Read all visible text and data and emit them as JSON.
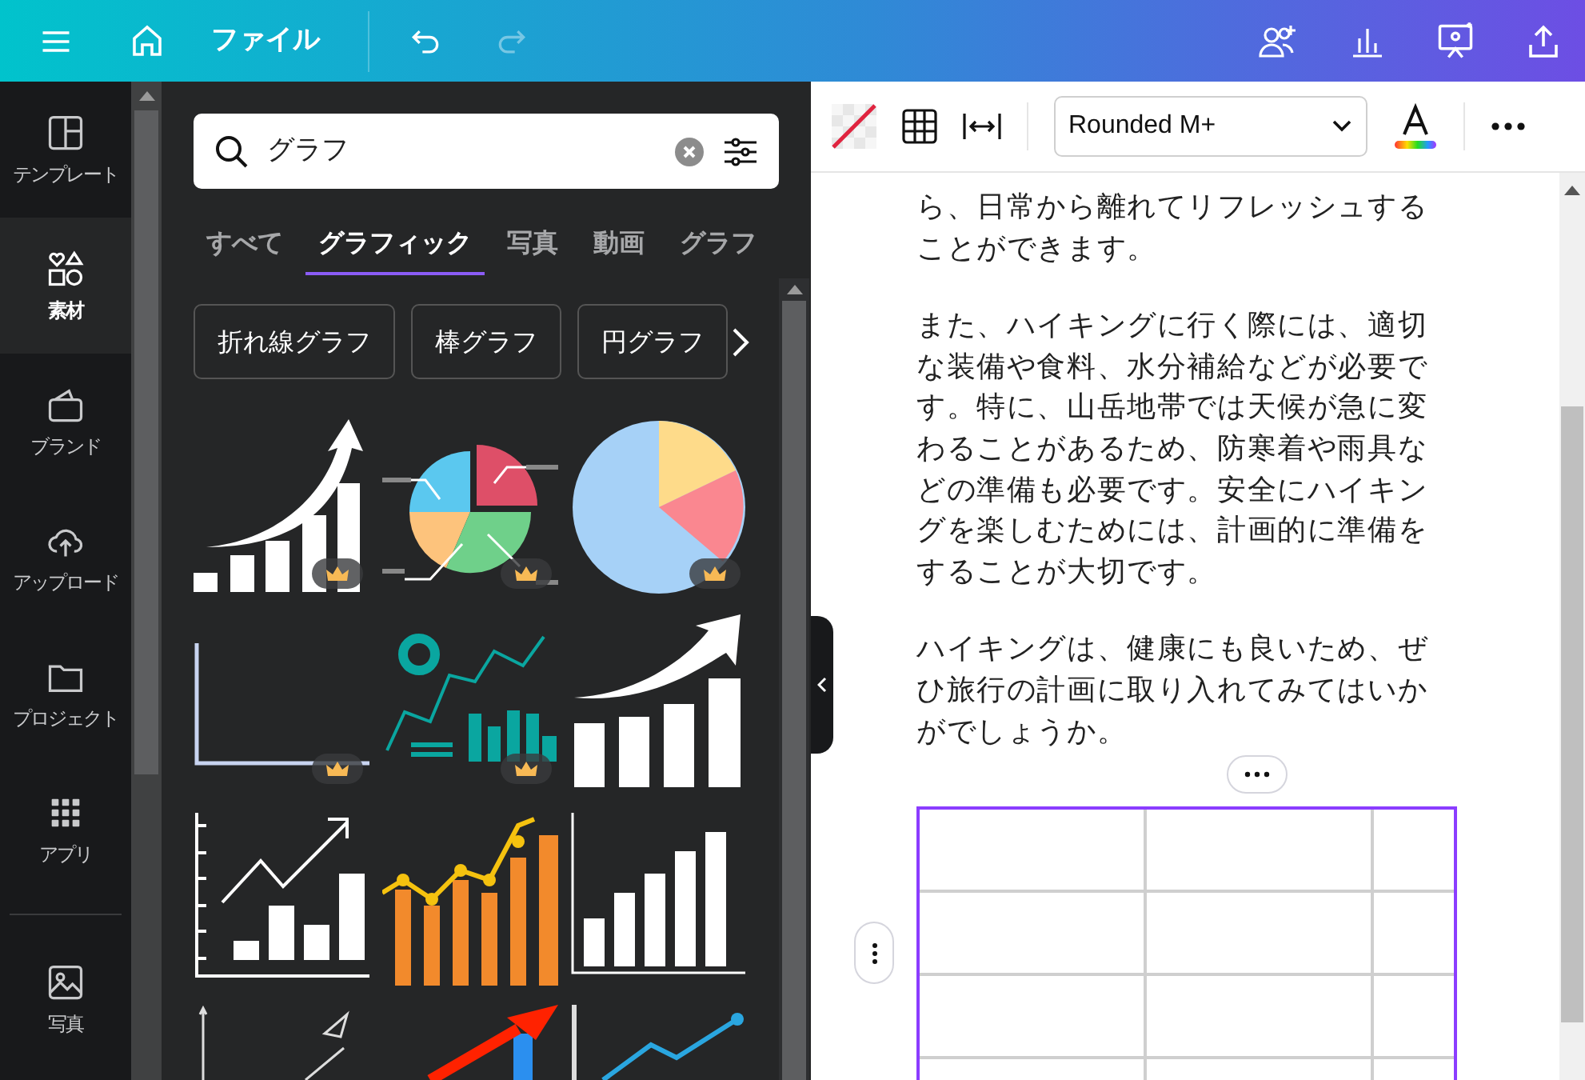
{
  "top_bar": {
    "file_menu": "ファイル",
    "redo_disabled": true
  },
  "rail": [
    {
      "label": "テンプレート",
      "kind": "template",
      "selected": false
    },
    {
      "label": "素材",
      "kind": "elements",
      "selected": true
    },
    {
      "label": "ブランド",
      "kind": "brand",
      "selected": false
    },
    {
      "label": "アップロード",
      "kind": "upload",
      "selected": false
    },
    {
      "label": "プロジェクト",
      "kind": "folder",
      "selected": false
    },
    {
      "label": "アプリ",
      "kind": "apps",
      "selected": false
    },
    {
      "label": "写真",
      "kind": "photo",
      "selected": false
    }
  ],
  "search": {
    "value": "グラフ"
  },
  "tabs": [
    {
      "label": "すべて",
      "selected": false
    },
    {
      "label": "グラフィック",
      "selected": true
    },
    {
      "label": "写真",
      "selected": false
    },
    {
      "label": "動画",
      "selected": false
    },
    {
      "label": "グラフ",
      "selected": false
    }
  ],
  "chips": [
    "折れ線グラフ",
    "棒グラフ",
    "円グラフ"
  ],
  "graphics": [
    {
      "kind": "bars-arrow",
      "premium": true
    },
    {
      "kind": "pie-callout",
      "premium": true
    },
    {
      "kind": "pie",
      "premium": true
    },
    {
      "kind": "axes",
      "premium": true
    },
    {
      "kind": "dashboard",
      "premium": true
    },
    {
      "kind": "bars-arrow-big",
      "premium": false
    },
    {
      "kind": "line-bars-axes",
      "premium": false
    },
    {
      "kind": "orange-bars",
      "premium": false
    },
    {
      "kind": "bars-axis",
      "premium": false
    },
    {
      "kind": "sketch",
      "premium": false
    },
    {
      "kind": "red-arrow",
      "premium": false
    },
    {
      "kind": "blue-line",
      "premium": false
    }
  ],
  "toolbar": {
    "font": "Rounded M+"
  },
  "document": {
    "paragraphs": [
      "ら、日常から離れてリフレッシュすることができます。",
      "また、ハイキングに行く際には、適切な装備や食料、水分補給などが必要です。特に、山岳地帯では天候が急に変わることがあるため、防寒着や雨具などの準備も必要です。安全にハイキングを楽しむためには、計画的に準備をすることが大切です。",
      "ハイキングは、健康にも良いため、ぜひ旅行の計画に取り入れてみてはいかがでしょうか。"
    ]
  }
}
